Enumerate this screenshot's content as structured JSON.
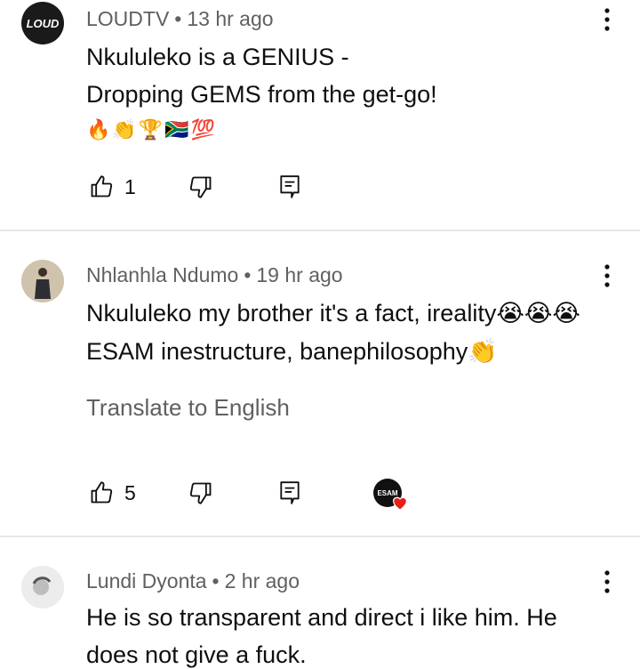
{
  "comments": [
    {
      "author": "LOUDTV",
      "time": "13 hr ago",
      "avatar_label": "LOUD",
      "lines": [
        "Nkululeko is a GENIUS -",
        "Dropping GEMS from the get-go!"
      ],
      "emoji_line": "🔥👏🏆🇿🇦💯",
      "likes": "1"
    },
    {
      "author": "Nhlanhla Ndumo",
      "time": "19 hr ago",
      "lines": [
        "Nkululeko my brother it's a fact, ireality😭😭😭",
        "ESAM inestructure, banephilosophy👏"
      ],
      "translate": "Translate to English",
      "likes": "5",
      "creator_badge": "ESAM"
    },
    {
      "author": "Lundi Dyonta",
      "time": "2 hr ago",
      "lines": [
        "He is so transparent and direct i like him. He",
        "does not give a fuck."
      ]
    }
  ],
  "separator": "•",
  "colors": {
    "meta": "#606060",
    "text": "#0f0f0f",
    "divider": "#e8e8e8",
    "heart": "#e62117"
  }
}
